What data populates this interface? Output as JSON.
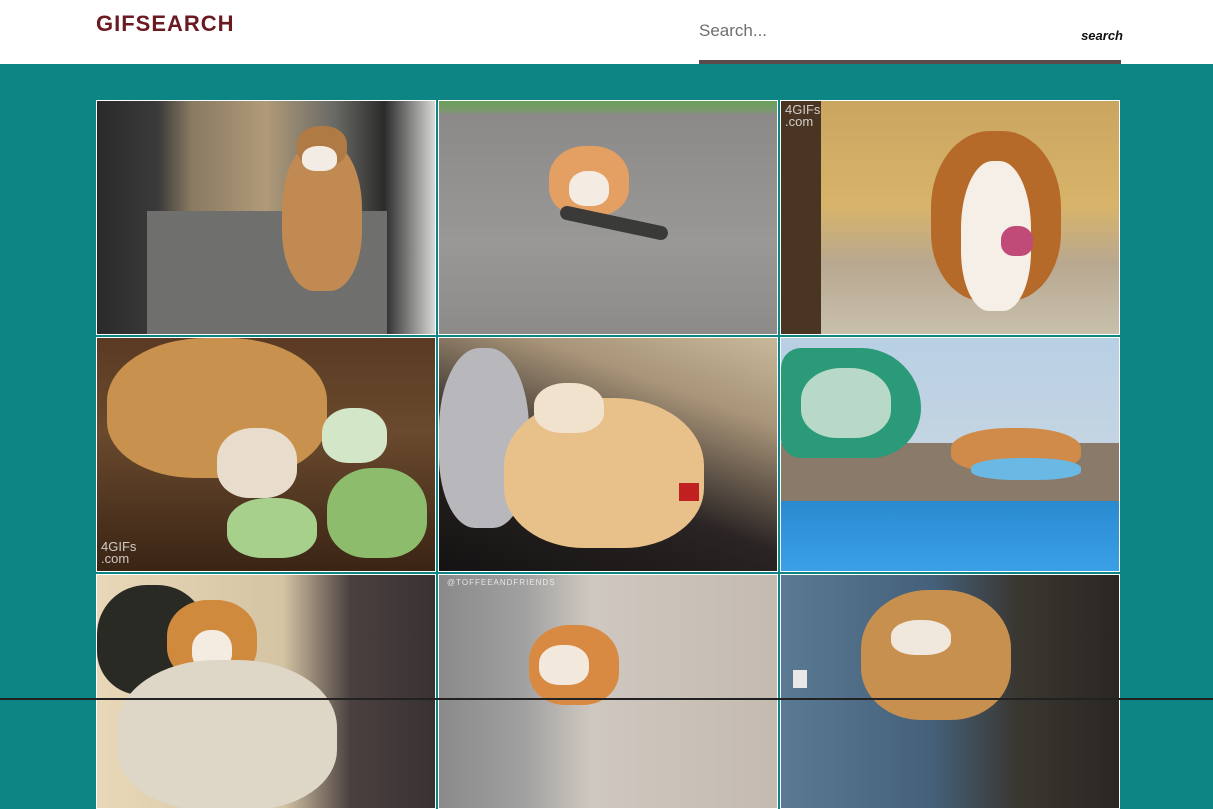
{
  "app": {
    "logo": "GIFSEARCH"
  },
  "search": {
    "placeholder": "Search...",
    "value": "",
    "button_label": "search"
  },
  "colors": {
    "header_bg": "#ffffff",
    "page_bg": "#0d8584",
    "logo": "#6b1a22",
    "search_underline": "#5a4a4c"
  },
  "results": [
    {
      "subject": "corgi walking down hallway",
      "watermark": ""
    },
    {
      "subject": "corgi riding skateboard",
      "watermark": ""
    },
    {
      "subject": "corgi running toward camera",
      "watermark": "4GIFs\n.com"
    },
    {
      "subject": "corgi eating cabbage",
      "watermark": "4GIFs\n.com"
    },
    {
      "subject": "corgi rolling on couch",
      "watermark": ""
    },
    {
      "subject": "corgi sliding into pool",
      "watermark": ""
    },
    {
      "subject": "corgi wrapped in blanket",
      "watermark": ""
    },
    {
      "subject": "corgi sitting on floor",
      "watermark": "@TOFFEEANDFRIENDS"
    },
    {
      "subject": "corgi jumping",
      "watermark": ""
    }
  ]
}
